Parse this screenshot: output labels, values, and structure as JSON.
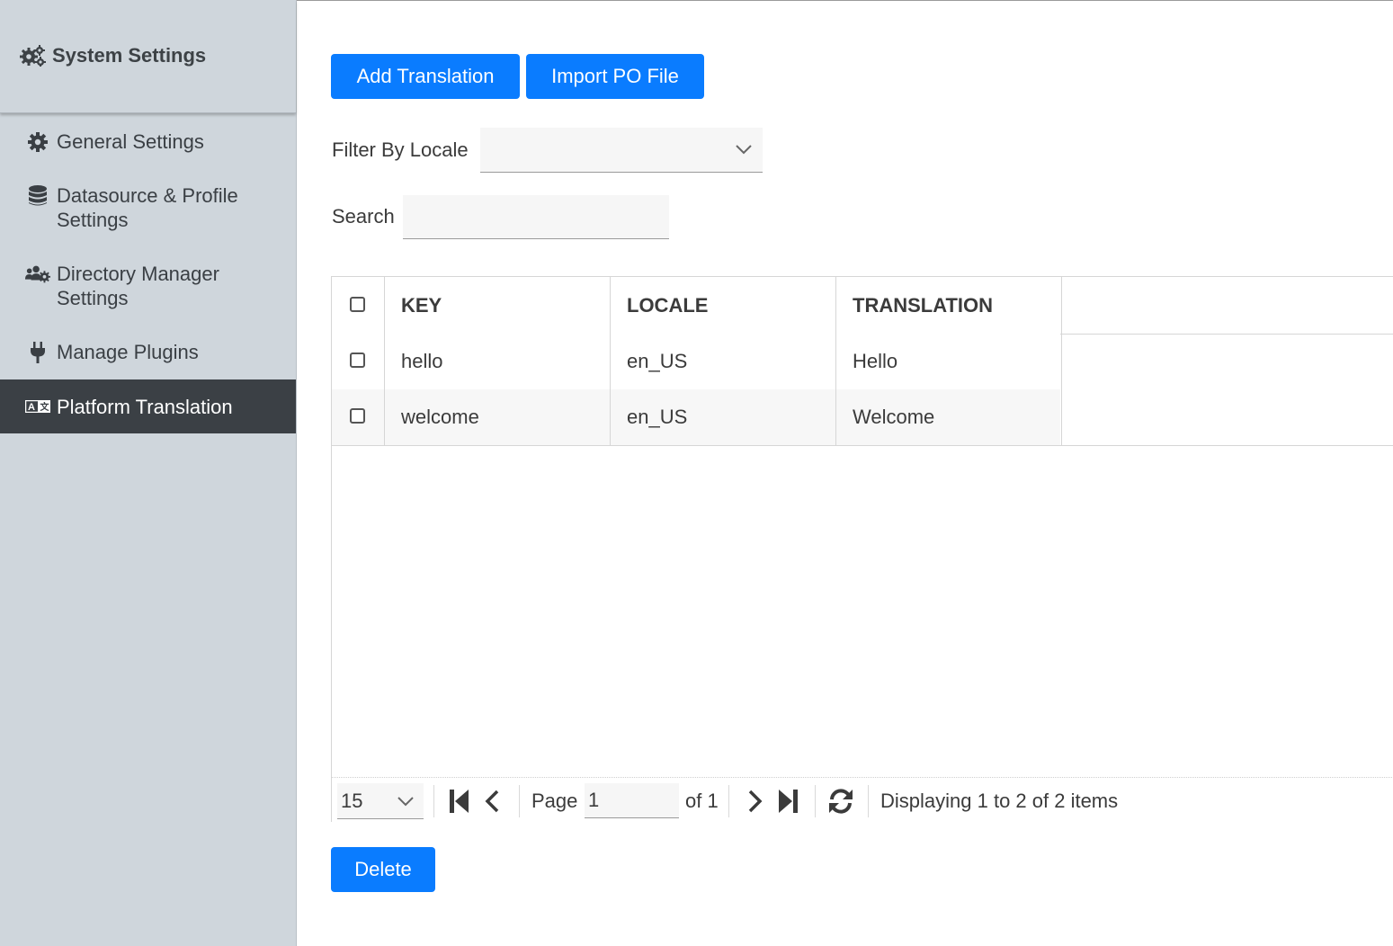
{
  "sidebar": {
    "title": "System Settings",
    "items": [
      {
        "label": "General Settings",
        "icon": "gear-icon"
      },
      {
        "label": "Datasource & Profile Settings",
        "icon": "database-icon"
      },
      {
        "label": "Directory Manager Settings",
        "icon": "users-cog-icon"
      },
      {
        "label": "Manage Plugins",
        "icon": "plug-icon"
      },
      {
        "label": "Platform Translation",
        "icon": "language-icon",
        "active": true
      }
    ]
  },
  "toolbar": {
    "add_label": "Add Translation",
    "import_label": "Import PO File"
  },
  "filter": {
    "label": "Filter By Locale",
    "value": ""
  },
  "search": {
    "label": "Search",
    "value": ""
  },
  "table": {
    "columns": [
      "KEY",
      "LOCALE",
      "TRANSLATION"
    ],
    "rows": [
      {
        "key": "hello",
        "locale": "en_US",
        "translation": "Hello"
      },
      {
        "key": "welcome",
        "locale": "en_US",
        "translation": "Welcome"
      }
    ]
  },
  "pager": {
    "page_size": "15",
    "page_label": "Page",
    "page_value": "1",
    "of_label": "of 1",
    "summary": "Displaying 1 to 2 of 2 items"
  },
  "actions": {
    "delete_label": "Delete"
  },
  "colors": {
    "accent": "#0a7cff",
    "sidebar_bg": "#cfd6dc",
    "sidebar_active": "#3b4045"
  }
}
